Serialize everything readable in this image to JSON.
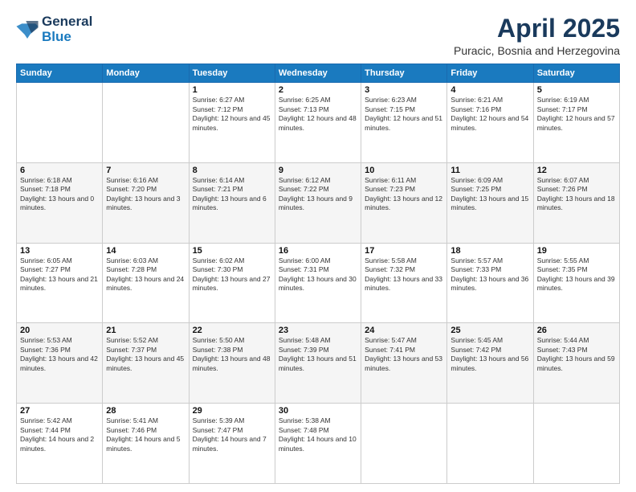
{
  "header": {
    "logo_general": "General",
    "logo_blue": "Blue",
    "month_title": "April 2025",
    "location": "Puracic, Bosnia and Herzegovina"
  },
  "weekdays": [
    "Sunday",
    "Monday",
    "Tuesday",
    "Wednesday",
    "Thursday",
    "Friday",
    "Saturday"
  ],
  "weeks": [
    [
      null,
      null,
      {
        "day": "1",
        "sunrise": "Sunrise: 6:27 AM",
        "sunset": "Sunset: 7:12 PM",
        "daylight": "Daylight: 12 hours and 45 minutes."
      },
      {
        "day": "2",
        "sunrise": "Sunrise: 6:25 AM",
        "sunset": "Sunset: 7:13 PM",
        "daylight": "Daylight: 12 hours and 48 minutes."
      },
      {
        "day": "3",
        "sunrise": "Sunrise: 6:23 AM",
        "sunset": "Sunset: 7:15 PM",
        "daylight": "Daylight: 12 hours and 51 minutes."
      },
      {
        "day": "4",
        "sunrise": "Sunrise: 6:21 AM",
        "sunset": "Sunset: 7:16 PM",
        "daylight": "Daylight: 12 hours and 54 minutes."
      },
      {
        "day": "5",
        "sunrise": "Sunrise: 6:19 AM",
        "sunset": "Sunset: 7:17 PM",
        "daylight": "Daylight: 12 hours and 57 minutes."
      }
    ],
    [
      {
        "day": "6",
        "sunrise": "Sunrise: 6:18 AM",
        "sunset": "Sunset: 7:18 PM",
        "daylight": "Daylight: 13 hours and 0 minutes."
      },
      {
        "day": "7",
        "sunrise": "Sunrise: 6:16 AM",
        "sunset": "Sunset: 7:20 PM",
        "daylight": "Daylight: 13 hours and 3 minutes."
      },
      {
        "day": "8",
        "sunrise": "Sunrise: 6:14 AM",
        "sunset": "Sunset: 7:21 PM",
        "daylight": "Daylight: 13 hours and 6 minutes."
      },
      {
        "day": "9",
        "sunrise": "Sunrise: 6:12 AM",
        "sunset": "Sunset: 7:22 PM",
        "daylight": "Daylight: 13 hours and 9 minutes."
      },
      {
        "day": "10",
        "sunrise": "Sunrise: 6:11 AM",
        "sunset": "Sunset: 7:23 PM",
        "daylight": "Daylight: 13 hours and 12 minutes."
      },
      {
        "day": "11",
        "sunrise": "Sunrise: 6:09 AM",
        "sunset": "Sunset: 7:25 PM",
        "daylight": "Daylight: 13 hours and 15 minutes."
      },
      {
        "day": "12",
        "sunrise": "Sunrise: 6:07 AM",
        "sunset": "Sunset: 7:26 PM",
        "daylight": "Daylight: 13 hours and 18 minutes."
      }
    ],
    [
      {
        "day": "13",
        "sunrise": "Sunrise: 6:05 AM",
        "sunset": "Sunset: 7:27 PM",
        "daylight": "Daylight: 13 hours and 21 minutes."
      },
      {
        "day": "14",
        "sunrise": "Sunrise: 6:03 AM",
        "sunset": "Sunset: 7:28 PM",
        "daylight": "Daylight: 13 hours and 24 minutes."
      },
      {
        "day": "15",
        "sunrise": "Sunrise: 6:02 AM",
        "sunset": "Sunset: 7:30 PM",
        "daylight": "Daylight: 13 hours and 27 minutes."
      },
      {
        "day": "16",
        "sunrise": "Sunrise: 6:00 AM",
        "sunset": "Sunset: 7:31 PM",
        "daylight": "Daylight: 13 hours and 30 minutes."
      },
      {
        "day": "17",
        "sunrise": "Sunrise: 5:58 AM",
        "sunset": "Sunset: 7:32 PM",
        "daylight": "Daylight: 13 hours and 33 minutes."
      },
      {
        "day": "18",
        "sunrise": "Sunrise: 5:57 AM",
        "sunset": "Sunset: 7:33 PM",
        "daylight": "Daylight: 13 hours and 36 minutes."
      },
      {
        "day": "19",
        "sunrise": "Sunrise: 5:55 AM",
        "sunset": "Sunset: 7:35 PM",
        "daylight": "Daylight: 13 hours and 39 minutes."
      }
    ],
    [
      {
        "day": "20",
        "sunrise": "Sunrise: 5:53 AM",
        "sunset": "Sunset: 7:36 PM",
        "daylight": "Daylight: 13 hours and 42 minutes."
      },
      {
        "day": "21",
        "sunrise": "Sunrise: 5:52 AM",
        "sunset": "Sunset: 7:37 PM",
        "daylight": "Daylight: 13 hours and 45 minutes."
      },
      {
        "day": "22",
        "sunrise": "Sunrise: 5:50 AM",
        "sunset": "Sunset: 7:38 PM",
        "daylight": "Daylight: 13 hours and 48 minutes."
      },
      {
        "day": "23",
        "sunrise": "Sunrise: 5:48 AM",
        "sunset": "Sunset: 7:39 PM",
        "daylight": "Daylight: 13 hours and 51 minutes."
      },
      {
        "day": "24",
        "sunrise": "Sunrise: 5:47 AM",
        "sunset": "Sunset: 7:41 PM",
        "daylight": "Daylight: 13 hours and 53 minutes."
      },
      {
        "day": "25",
        "sunrise": "Sunrise: 5:45 AM",
        "sunset": "Sunset: 7:42 PM",
        "daylight": "Daylight: 13 hours and 56 minutes."
      },
      {
        "day": "26",
        "sunrise": "Sunrise: 5:44 AM",
        "sunset": "Sunset: 7:43 PM",
        "daylight": "Daylight: 13 hours and 59 minutes."
      }
    ],
    [
      {
        "day": "27",
        "sunrise": "Sunrise: 5:42 AM",
        "sunset": "Sunset: 7:44 PM",
        "daylight": "Daylight: 14 hours and 2 minutes."
      },
      {
        "day": "28",
        "sunrise": "Sunrise: 5:41 AM",
        "sunset": "Sunset: 7:46 PM",
        "daylight": "Daylight: 14 hours and 5 minutes."
      },
      {
        "day": "29",
        "sunrise": "Sunrise: 5:39 AM",
        "sunset": "Sunset: 7:47 PM",
        "daylight": "Daylight: 14 hours and 7 minutes."
      },
      {
        "day": "30",
        "sunrise": "Sunrise: 5:38 AM",
        "sunset": "Sunset: 7:48 PM",
        "daylight": "Daylight: 14 hours and 10 minutes."
      },
      null,
      null,
      null
    ]
  ]
}
